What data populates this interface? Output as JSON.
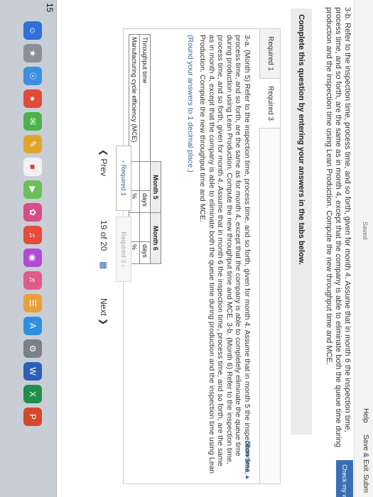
{
  "header": {
    "saved": "Saved",
    "help": "Help",
    "save_exit": "Save & Exit",
    "submit": "Subm",
    "check_work": "Check my work"
  },
  "question": {
    "text": "3-b. Refer to the inspection time, process time, and so forth, given for month 4. Assume that in month 6 the inspection time, process time, and so forth, are the same as in month 4, except that the company is able to eliminate both the queue time during production and the inspection time using Lean Production. Compute the new throughput time and MCE."
  },
  "instruction": "Complete this question by entering your answers in the tabs below.",
  "tabs": [
    {
      "label": "Required 1"
    },
    {
      "label": "Required 3"
    }
  ],
  "panel": {
    "text": "3-a. (Month 5) Refer to the inspection time, process time, and so forth, given for month 4. Assume that in month 5 the inspection time, process time, and so forth, are the same as for month 4, except that the company is able to completely eliminate the queue time during production using Lean Production. Compute the new throughput time and MCE. 3-b. (Month 6) Refer to the inspection time, process time, and so forth, given for month 4. Assume that in month 6 the inspection time, process time, and so forth, are the same as in month 4, except that the company is able to eliminate both the queue time during production and the inspection time using Lean Production. Compute the new throughput time and MCE.",
    "round": "(Round your answers to 1 decimal place.)",
    "show_less": "Show less ▲"
  },
  "table": {
    "columns": [
      "Month 5",
      "Month 6"
    ],
    "rows": [
      {
        "label": "Throughput time",
        "unit": "days"
      },
      {
        "label": "Manufacturing cycle efficiency (MCE)",
        "unit": "%"
      }
    ]
  },
  "nav": {
    "prev_required": "Required 1",
    "next_required": "Required 3"
  },
  "pager": {
    "prev": "Prev",
    "page": "19",
    "of": "of 20",
    "next": "Next"
  },
  "dock": {
    "badge": "15"
  }
}
